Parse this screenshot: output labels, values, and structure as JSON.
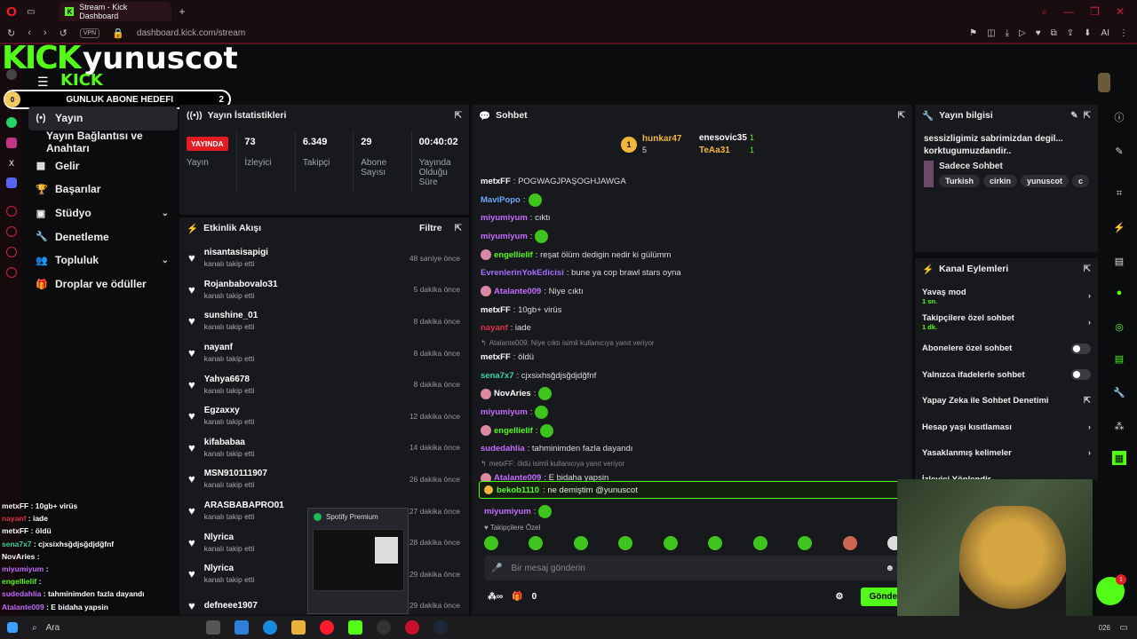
{
  "browser": {
    "tab_title": "Stream - Kick Dashboard",
    "tab_add": "+",
    "url": "dashboard.kick.com/stream",
    "vpn": "VPN",
    "ai_label": "AI"
  },
  "overlay": {
    "kick_logo": "KICK",
    "streamer_name": "yunuscot",
    "kick_small": "KICK",
    "sub_goal_label": "GUNLUK ABONE HEDEFI",
    "sub_goal_current": "0",
    "sub_goal_target": "2"
  },
  "nav": {
    "items": [
      {
        "label": "Yayın",
        "icon": "broadcast-icon",
        "glyph": "(•)",
        "active": true
      },
      {
        "label": "Yayın Bağlantısı ve Anahtarı",
        "icon": "",
        "glyph": ""
      },
      {
        "label": "Gelir",
        "icon": "chart-icon",
        "glyph": "▦"
      },
      {
        "label": "Başarılar",
        "icon": "trophy-icon",
        "glyph": "🏆"
      },
      {
        "label": "Stüdyo",
        "icon": "studio-icon",
        "glyph": "▣",
        "chevron": "⌄"
      },
      {
        "label": "Denetleme",
        "icon": "wrench-icon",
        "glyph": "🔧"
      },
      {
        "label": "Topluluk",
        "icon": "people-icon",
        "glyph": "👥",
        "chevron": "⌄"
      },
      {
        "label": "Droplar ve ödüller",
        "icon": "gift-icon",
        "glyph": "🎁"
      }
    ]
  },
  "stats": {
    "title": "Yayın İstatistikleri",
    "cols": [
      {
        "value": "YAYINDA",
        "label": "Yayın",
        "live": true
      },
      {
        "value": "73",
        "label": "İzleyici"
      },
      {
        "value": "6.349",
        "label": "Takipçi"
      },
      {
        "value": "29",
        "label": "Abone Sayısı"
      },
      {
        "value": "00:40:02",
        "label": "Yayında Olduğu Süre"
      }
    ]
  },
  "activity": {
    "title": "Etkinlik Akışı",
    "filter": "Filtre",
    "items": [
      {
        "name": "nisantasisapigi",
        "sub": "kanalı takip etti",
        "time": "48 saniye önce"
      },
      {
        "name": "Rojanbabovalo31",
        "sub": "kanalı takip etti",
        "time": "5 dakika önce"
      },
      {
        "name": "sunshine_01",
        "sub": "kanalı takip etti",
        "time": "8 dakika önce"
      },
      {
        "name": "nayanf",
        "sub": "kanalı takip etti",
        "time": "8 dakika önce"
      },
      {
        "name": "Yahya6678",
        "sub": "kanalı takip etti",
        "time": "8 dakika önce"
      },
      {
        "name": "Egzaxxy",
        "sub": "kanalı takip etti",
        "time": "12 dakika önce"
      },
      {
        "name": "kifababaa",
        "sub": "kanalı takip etti",
        "time": "14 dakika önce"
      },
      {
        "name": "MSN910111907",
        "sub": "kanalı takip etti",
        "time": "26 dakika önce"
      },
      {
        "name": "ARASBABAPRO01",
        "sub": "kanalı takip etti",
        "time": "27 dakika önce"
      },
      {
        "name": "Nlyrica",
        "sub": "kanalı takip etti",
        "time": "28 dakika önce"
      },
      {
        "name": "Nlyrica",
        "sub": "kanalı takip etti",
        "time": "29 dakika önce"
      },
      {
        "name": "defneee1907",
        "sub": "",
        "time": "29 dakika önce"
      }
    ]
  },
  "chat": {
    "title": "Sohbet",
    "pinned": [
      {
        "name": "hunkar47",
        "count": "5",
        "rank": "1"
      },
      {
        "name": "enesovic35",
        "count": "1"
      },
      {
        "name": "TeAa31",
        "count": "1"
      }
    ],
    "lines": [
      {
        "user": "metxFF",
        "text": ": POGWAGJPAŞOGHJAWGA",
        "color": "#ffffff"
      },
      {
        "user": "MaviPopo",
        "text": ":",
        "color": "#6fa8ff",
        "emote": true
      },
      {
        "user": "miyumiyum",
        "text": ": cıktı",
        "color": "#c56cff"
      },
      {
        "user": "miyumiyum",
        "text": ":",
        "color": "#c56cff",
        "emote": true
      },
      {
        "user": "engellielif",
        "text": ": reşat ölüm dedigin nedir ki gülümm",
        "color": "#53fc18",
        "badge": true
      },
      {
        "user": "EvrenlerinYokEdicisi",
        "text": ": bune ya cop brawl stars oyna",
        "color": "#a070ff"
      },
      {
        "user": "Atalante009",
        "text": ": Niye cıktı",
        "color": "#c56cff",
        "badge": true
      },
      {
        "user": "metxFF",
        "text": ": 10gb+ virüs",
        "color": "#ffffff"
      },
      {
        "user": "nayanf",
        "text": ": iade",
        "color": "#e0314a"
      },
      {
        "reply": "Atalante009: Niye cıktı isimli kullanıcıya yanıt veriyor"
      },
      {
        "user": "metxFF",
        "text": ": öldü",
        "color": "#ffffff"
      },
      {
        "user": "sena7x7",
        "text": ": cjxsixhsğdjsğdjdğfnf",
        "color": "#35d6a0"
      },
      {
        "user": "NovAries",
        "text": ":",
        "color": "#ffffff",
        "badge": true,
        "emote": true
      },
      {
        "user": "miyumiyum",
        "text": ":",
        "color": "#c56cff",
        "emote": true
      },
      {
        "user": "engellielif",
        "text": ":",
        "color": "#53fc18",
        "badge": true,
        "emote": true
      },
      {
        "user": "sudedahlia",
        "text": ": tahminimden fazla dayandı",
        "color": "#c56cff"
      },
      {
        "reply": "metxFF: öldü isimli kullanıcıya yanıt veriyor"
      },
      {
        "user": "Atalante009",
        "text": ": E bidaha yapsin",
        "color": "#c56cff",
        "badge": true
      }
    ],
    "highlight": {
      "user": "bekob1110",
      "text": ": ne demiştim @yunuscot"
    },
    "after": {
      "user": "miyumiyum",
      "text": ":"
    },
    "followers_only": "Takipçilere Özel",
    "input_placeholder": "Bir mesaj gönderin",
    "points": "0",
    "send": "Gönder"
  },
  "info": {
    "title": "Yayın bilgisi",
    "stream_title": "sessizligimiz sabrimizdan degil... korktugumuzdandir..",
    "category": "Sadece Sohbet",
    "tags": [
      "Turkish",
      "cirkin",
      "yunuscot",
      "c"
    ]
  },
  "actions": {
    "title": "Kanal Eylemleri",
    "rows": [
      {
        "label": "Yavaş mod",
        "sub": "1 sn.",
        "type": "chevron"
      },
      {
        "label": "Takipçilere özel sohbet",
        "sub": "1 dk.",
        "type": "chevron"
      },
      {
        "label": "Abonelere özel sohbet",
        "sub": "",
        "type": "toggle"
      },
      {
        "label": "Yalnızca ifadelerle sohbet",
        "sub": "",
        "type": "toggle"
      },
      {
        "label": "Yapay Zeka ile Sohbet Denetimi",
        "sub": "",
        "type": "external"
      },
      {
        "label": "Hesap yaşı kısıtlaması",
        "sub": "",
        "type": "chevron"
      },
      {
        "label": "Yasaklanmış kelimeler",
        "sub": "",
        "type": "chevron"
      },
      {
        "label": "İzleyici Yönlendir",
        "sub": "",
        "type": "none"
      }
    ]
  },
  "obs_chat": [
    {
      "user": "metxFF",
      "text": " : 10gb+ virüs",
      "color": "#ffffff"
    },
    {
      "user": "nayanf",
      "text": " : iade",
      "color": "#e0314a"
    },
    {
      "user": "metxFF",
      "text": " : öldü",
      "color": "#ffffff"
    },
    {
      "user": "sena7x7",
      "text": " : cjxsixhsğdjsğdjdğfnf",
      "color": "#35d6a0"
    },
    {
      "user": "NovAries",
      "text": " :",
      "color": "#ffffff"
    },
    {
      "user": "miyumiyum",
      "text": " :",
      "color": "#c56cff"
    },
    {
      "user": "engellielif",
      "text": " :",
      "color": "#53fc18"
    },
    {
      "user": "sudedahlia",
      "text": " : tahminimden fazla dayandı",
      "color": "#c56cff"
    },
    {
      "user": "Atalante009",
      "text": " : E bidaha yapsin",
      "color": "#c56cff"
    },
    {
      "user": "bekob1110",
      "text": " : ne demiştim @yunuscot",
      "color": "#53fc18"
    }
  ],
  "spotify": {
    "title": "Spotify Premium"
  },
  "taskbar": {
    "search": "Ara",
    "clock": "026"
  },
  "notification_count": "1"
}
